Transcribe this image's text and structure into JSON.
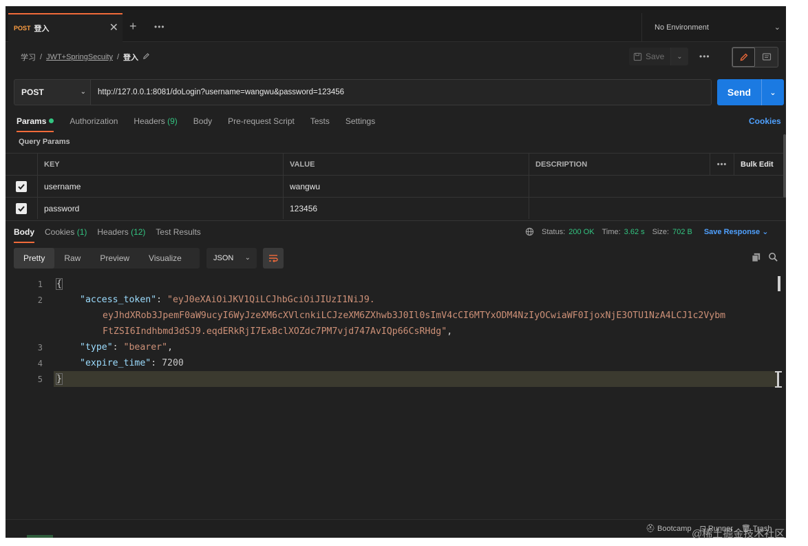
{
  "tab": {
    "method": "POST",
    "name": "登入",
    "close": "✕",
    "new_tab": "+",
    "more": "•••"
  },
  "environment": {
    "label": "No Environment"
  },
  "breadcrumb": {
    "workspace": "学习",
    "collection": "JWT+SpringSecuity",
    "request": "登入",
    "separator": "/"
  },
  "toolbar": {
    "save_label": "Save",
    "more": "•••"
  },
  "request": {
    "method": "POST",
    "url": "http://127.0.0.1:8081/doLogin?username=wangwu&password=123456",
    "send_label": "Send"
  },
  "request_tabs": [
    {
      "label": "Params",
      "count": "",
      "active": true
    },
    {
      "label": "Authorization",
      "count": ""
    },
    {
      "label": "Headers",
      "count": "(9)"
    },
    {
      "label": "Body",
      "count": ""
    },
    {
      "label": "Pre-request Script",
      "count": ""
    },
    {
      "label": "Tests",
      "count": ""
    },
    {
      "label": "Settings",
      "count": ""
    }
  ],
  "cookies_link": "Cookies",
  "query_params_title": "Query Params",
  "params_table": {
    "headers": {
      "key": "KEY",
      "value": "VALUE",
      "description": "DESCRIPTION",
      "more": "•••",
      "bulk_edit": "Bulk Edit"
    },
    "rows": [
      {
        "checked": true,
        "key": "username",
        "value": "wangwu",
        "description": ""
      },
      {
        "checked": true,
        "key": "password",
        "value": "123456",
        "description": ""
      }
    ]
  },
  "response_tabs": [
    {
      "label": "Body",
      "count": "",
      "active": true
    },
    {
      "label": "Cookies",
      "count": "(1)"
    },
    {
      "label": "Headers",
      "count": "(12)"
    },
    {
      "label": "Test Results",
      "count": ""
    }
  ],
  "response_status": {
    "status_label": "Status:",
    "status_value": "200 OK",
    "time_label": "Time:",
    "time_value": "3.62 s",
    "size_label": "Size:",
    "size_value": "702 B",
    "save_response": "Save Response"
  },
  "viewer": {
    "modes": [
      "Pretty",
      "Raw",
      "Preview",
      "Visualize"
    ],
    "active_mode": "Pretty",
    "format": "JSON"
  },
  "code_lines": {
    "l1": {
      "num": "1",
      "text": "{"
    },
    "l2": {
      "num": "2",
      "key": "\"access_token\"",
      "colon": ": ",
      "value": "\"eyJ0eXAiOiJKV1QiLCJhbGciOiJIUzI1NiJ9."
    },
    "l2b": {
      "value": "eyJhdXRob3JpemF0aW9ucyI6WyJzeXM6cXVlcnkiLCJzeXM6ZXhwb3J0Il0sImV4cCI6MTYxODM4NzIyOCwiaWF0IjoxNjE3OTU1NzA4LCJ1c2Vybm"
    },
    "l2c": {
      "value": "FtZSI6Indhbmd3dSJ9.eqdERkRjI7ExBclXOZdc7PM7vjd747AvIQp66CsRHdg\"",
      "comma": ","
    },
    "l3": {
      "num": "3",
      "key": "\"type\"",
      "colon": ": ",
      "value": "\"bearer\"",
      "comma": ","
    },
    "l4": {
      "num": "4",
      "key": "\"expire_time\"",
      "colon": ": ",
      "value": "7200"
    },
    "l5": {
      "num": "5",
      "text": "}"
    }
  },
  "statusbar": {
    "bootcamp": "Bootcamp",
    "runner": "Runner",
    "trash": "Trash"
  },
  "watermark": "@稀土掘金技术社区",
  "colors": {
    "accent_orange": "#f26b3a",
    "send_blue": "#1b7ae2",
    "link_blue": "#4fa1ff",
    "status_green": "#33c481",
    "json_key": "#9cdcfe",
    "json_string": "#ce9178"
  }
}
